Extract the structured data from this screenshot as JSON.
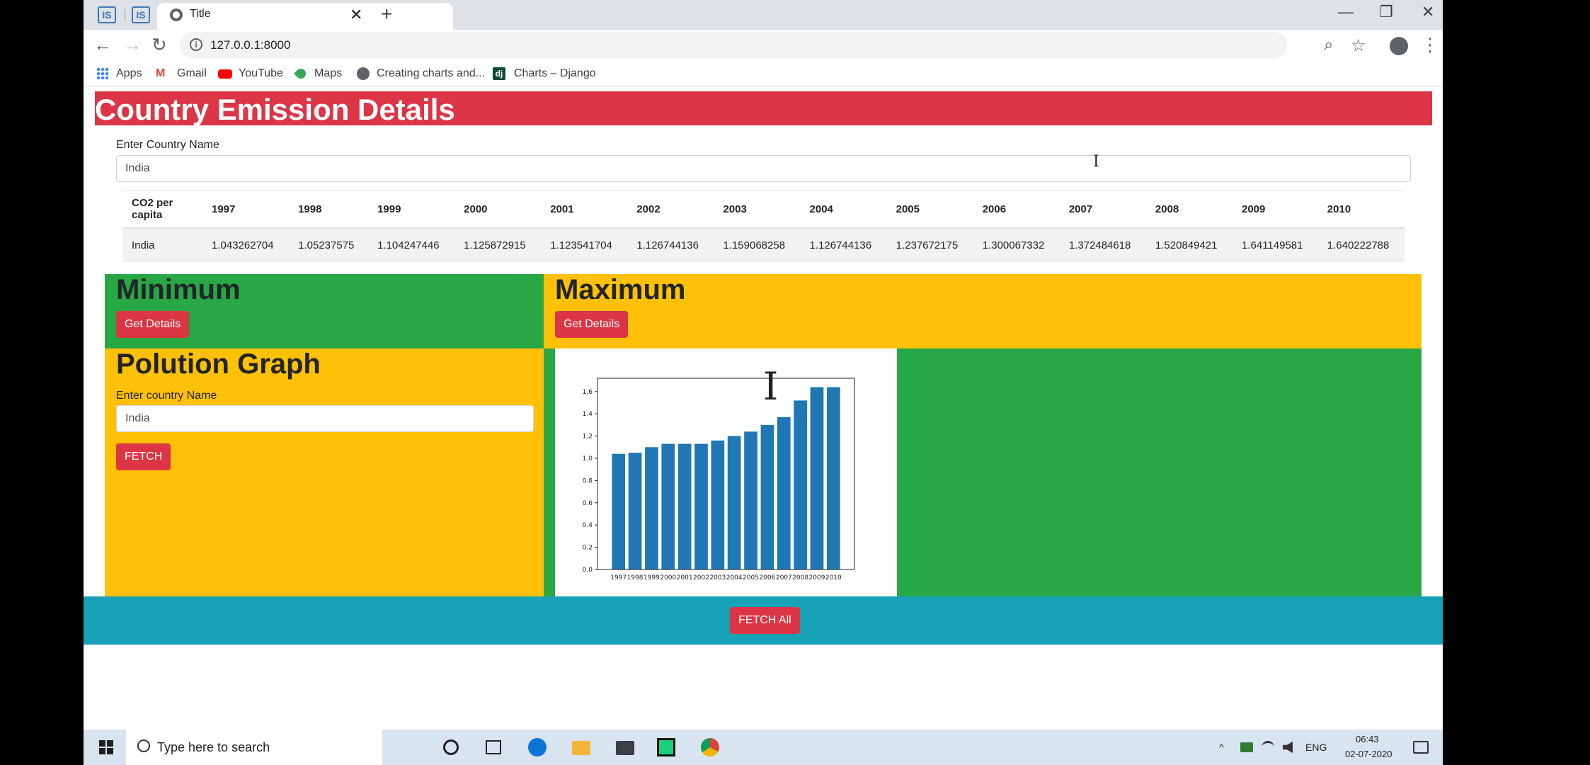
{
  "browser": {
    "pinned_tabs": [
      "IS",
      "IS"
    ],
    "active_tab_title": "Title",
    "tab_close": "✕",
    "new_tab": "+",
    "url": "127.0.0.1:8000",
    "win_minimize": "—",
    "win_restore": "❐",
    "win_close": "✕",
    "back": "←",
    "forward": "→",
    "reload": "↻",
    "zoom_icon": "⌕",
    "star_icon": "☆",
    "menu_icon": "⋮",
    "info_icon": "i",
    "bookmarks": [
      {
        "label": "Apps",
        "icon": "apps-grid-icon"
      },
      {
        "label": "Gmail",
        "icon": "gmail-icon"
      },
      {
        "label": "YouTube",
        "icon": "youtube-icon"
      },
      {
        "label": "Maps",
        "icon": "maps-icon"
      },
      {
        "label": "Creating charts and...",
        "icon": "globe-icon"
      },
      {
        "label": "Charts – Django",
        "icon": "django-icon"
      }
    ],
    "gmail_glyph": "M",
    "django_glyph": "dj"
  },
  "page": {
    "title": "Country Emission Details",
    "country_label": "Enter Country Name",
    "country_value": "India",
    "cursor_glyph": "I",
    "table": {
      "headers": [
        "CO2 per capita",
        "1997",
        "1998",
        "1999",
        "2000",
        "2001",
        "2002",
        "2003",
        "2004",
        "2005",
        "2006",
        "2007",
        "2008",
        "2009",
        "2010"
      ],
      "rows": [
        [
          "India",
          "1.043262704",
          "1.05237575",
          "1.104247446",
          "1.125872915",
          "1.123541704",
          "1.126744136",
          "1.159068258",
          "1.126744136",
          "1.237672175",
          "1.300067332",
          "1.372484618",
          "1.520849421",
          "1.641149581",
          "1.640222788"
        ]
      ]
    },
    "minimum": {
      "heading": "Minimum",
      "button": "Get Details"
    },
    "maximum": {
      "heading": "Maximum",
      "button": "Get Details"
    },
    "graph": {
      "heading": "Polution Graph",
      "label": "Enter country Name",
      "value": "India",
      "button": "FETCH"
    },
    "footer_button": "FETCH All",
    "colors": {
      "danger": "#dc3545",
      "success": "#28a745",
      "warning": "#ffc107",
      "info": "#17a2b8",
      "bar": "#1f77b4"
    }
  },
  "chart_data": {
    "type": "bar",
    "categories": [
      "1997",
      "1998",
      "1999",
      "2000",
      "2001",
      "2002",
      "2003",
      "2004",
      "2005",
      "2006",
      "2007",
      "2008",
      "2009",
      "2010"
    ],
    "values": [
      1.04,
      1.05,
      1.1,
      1.13,
      1.13,
      1.13,
      1.16,
      1.2,
      1.24,
      1.3,
      1.37,
      1.52,
      1.64,
      1.64
    ],
    "yticks": [
      "0.0",
      "0.2",
      "0.4",
      "0.6",
      "0.8",
      "1.0",
      "1.2",
      "1.4",
      "1.6"
    ],
    "ylim": [
      0,
      1.72
    ],
    "title": "",
    "xlabel": "",
    "ylabel": "",
    "grid": false
  },
  "taskbar": {
    "search_placeholder": "Type here to search",
    "tray_chevron": "^",
    "language": "ENG",
    "time": "06:43",
    "date": "02-07-2020"
  }
}
